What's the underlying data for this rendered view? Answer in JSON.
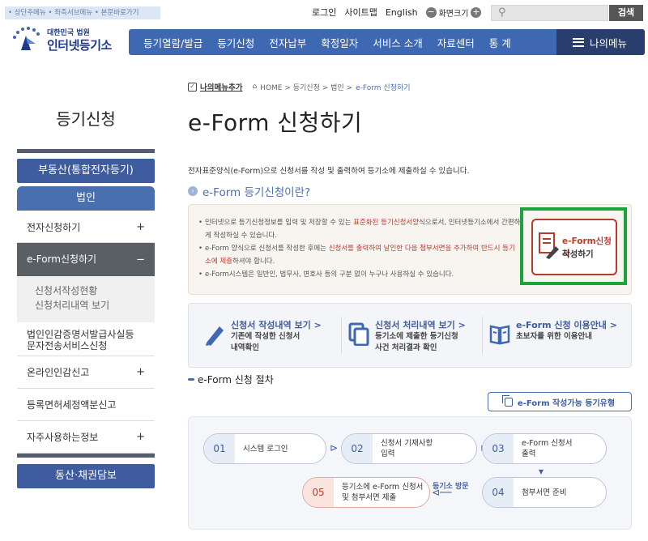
{
  "skip_nav": "• 상단주메뉴 • 좌측서브메뉴 • 본문바로가기",
  "util": {
    "login": "로그인",
    "sitemap": "사이트맵",
    "english": "English",
    "zoom": "화면크기"
  },
  "search": {
    "placeholder": "",
    "button": "검색"
  },
  "logo": {
    "line1": "대한민국 법원",
    "line2": "인터넷등기소"
  },
  "gnb": [
    "등기열람/발급",
    "등기신청",
    "전자납부",
    "확정일자",
    "서비스 소개",
    "자료센터",
    "통 계"
  ],
  "my_menu": "나의메뉴",
  "lnb": {
    "title": "등기신청",
    "btn_realestate": "부동산(통합전자등기)",
    "corp": "법인",
    "items": [
      {
        "label": "전자신청하기",
        "plus": "+"
      },
      {
        "label": "e-Form신청하기",
        "plus": "−"
      },
      {
        "label": "법인인감증명서발급사실등\n문자전송서비스신청",
        "plus": ""
      },
      {
        "label": "온라인인감신고",
        "plus": "+"
      },
      {
        "label": "등록면허세정액분신고",
        "plus": ""
      },
      {
        "label": "자주사용하는정보",
        "plus": "+"
      }
    ],
    "subs": [
      "신청서작성현황",
      "신청처리내역 보기"
    ],
    "btn_movable": "동산·채권담보"
  },
  "breadcrumb": {
    "fav": "나의메뉴추가",
    "path": "HOME > 등기신청 > 법인 >",
    "current": "e-Form 신청하기"
  },
  "page_title": "e-Form 신청하기",
  "intro": "전자표준양식(e-Form)으로 신청서를 작성 및 출력하여 등기소에 제출하실 수 있습니다.",
  "subheading": "e-Form 등기신청이란?",
  "info": {
    "b1a": "인터넷으로 등기신청정보를 입력 및 저장할 수 있는 ",
    "b1h": "표준화된 등기신청서양식",
    "b1b": "으로서, 인터넷등기소에서 간편하게 작성하실 수 있습니다.",
    "b2a": "e-Form 양식으로 신청서를 작성한 후에는 ",
    "b2h": "신청서를 출력하여 날인한 다음 첨부서면을 추가하여 반드시 등기소에 제출",
    "b2b": "하셔야 합니다.",
    "b3": "e-Form시스템은 일반인, 법무사, 변호사 등의 구분 없이 누구나 사용하실 수 있습니다."
  },
  "eform_button": {
    "line1": "e-Form신청서",
    "line2": "작성하기"
  },
  "quick": [
    {
      "title": "신청서 작성내역 보기 >",
      "desc1": "기존에 작성한 신청서",
      "desc2": "내역확인",
      "icon": "pencil-icon"
    },
    {
      "title": "신청서 처리내역 보기 >",
      "desc1": "등기소에 제출한 등기신청",
      "desc2": "사건 처리결과 확인",
      "icon": "documents-icon"
    },
    {
      "title": "e-Form 신청 이용안내 >",
      "desc1": "초보자를 위한 이용안내",
      "desc2": "",
      "icon": "book-icon"
    }
  ],
  "process_title": "e-Form 신청 절차",
  "type_button": "e-Form 작성가능 등기유형",
  "steps": [
    {
      "num": "01",
      "label1": "시스템 로그인",
      "label2": ""
    },
    {
      "num": "02",
      "label1": "신청서 기재사항",
      "label2": "입력"
    },
    {
      "num": "03",
      "label1": "e-Form 신청서",
      "label2": "출력"
    },
    {
      "num": "04",
      "label1": "첨부서면 준비",
      "label2": ""
    },
    {
      "num": "05",
      "label1": "등기소에 e-Form 신청서",
      "label2": "및 첨부서면 제출"
    }
  ],
  "visit_label": "등기소 방문",
  "colors": {
    "gnb": "#3f68b2",
    "mymenu": "#293e6c",
    "highlight": "#c0392b",
    "green_box": "#1aa53a"
  }
}
